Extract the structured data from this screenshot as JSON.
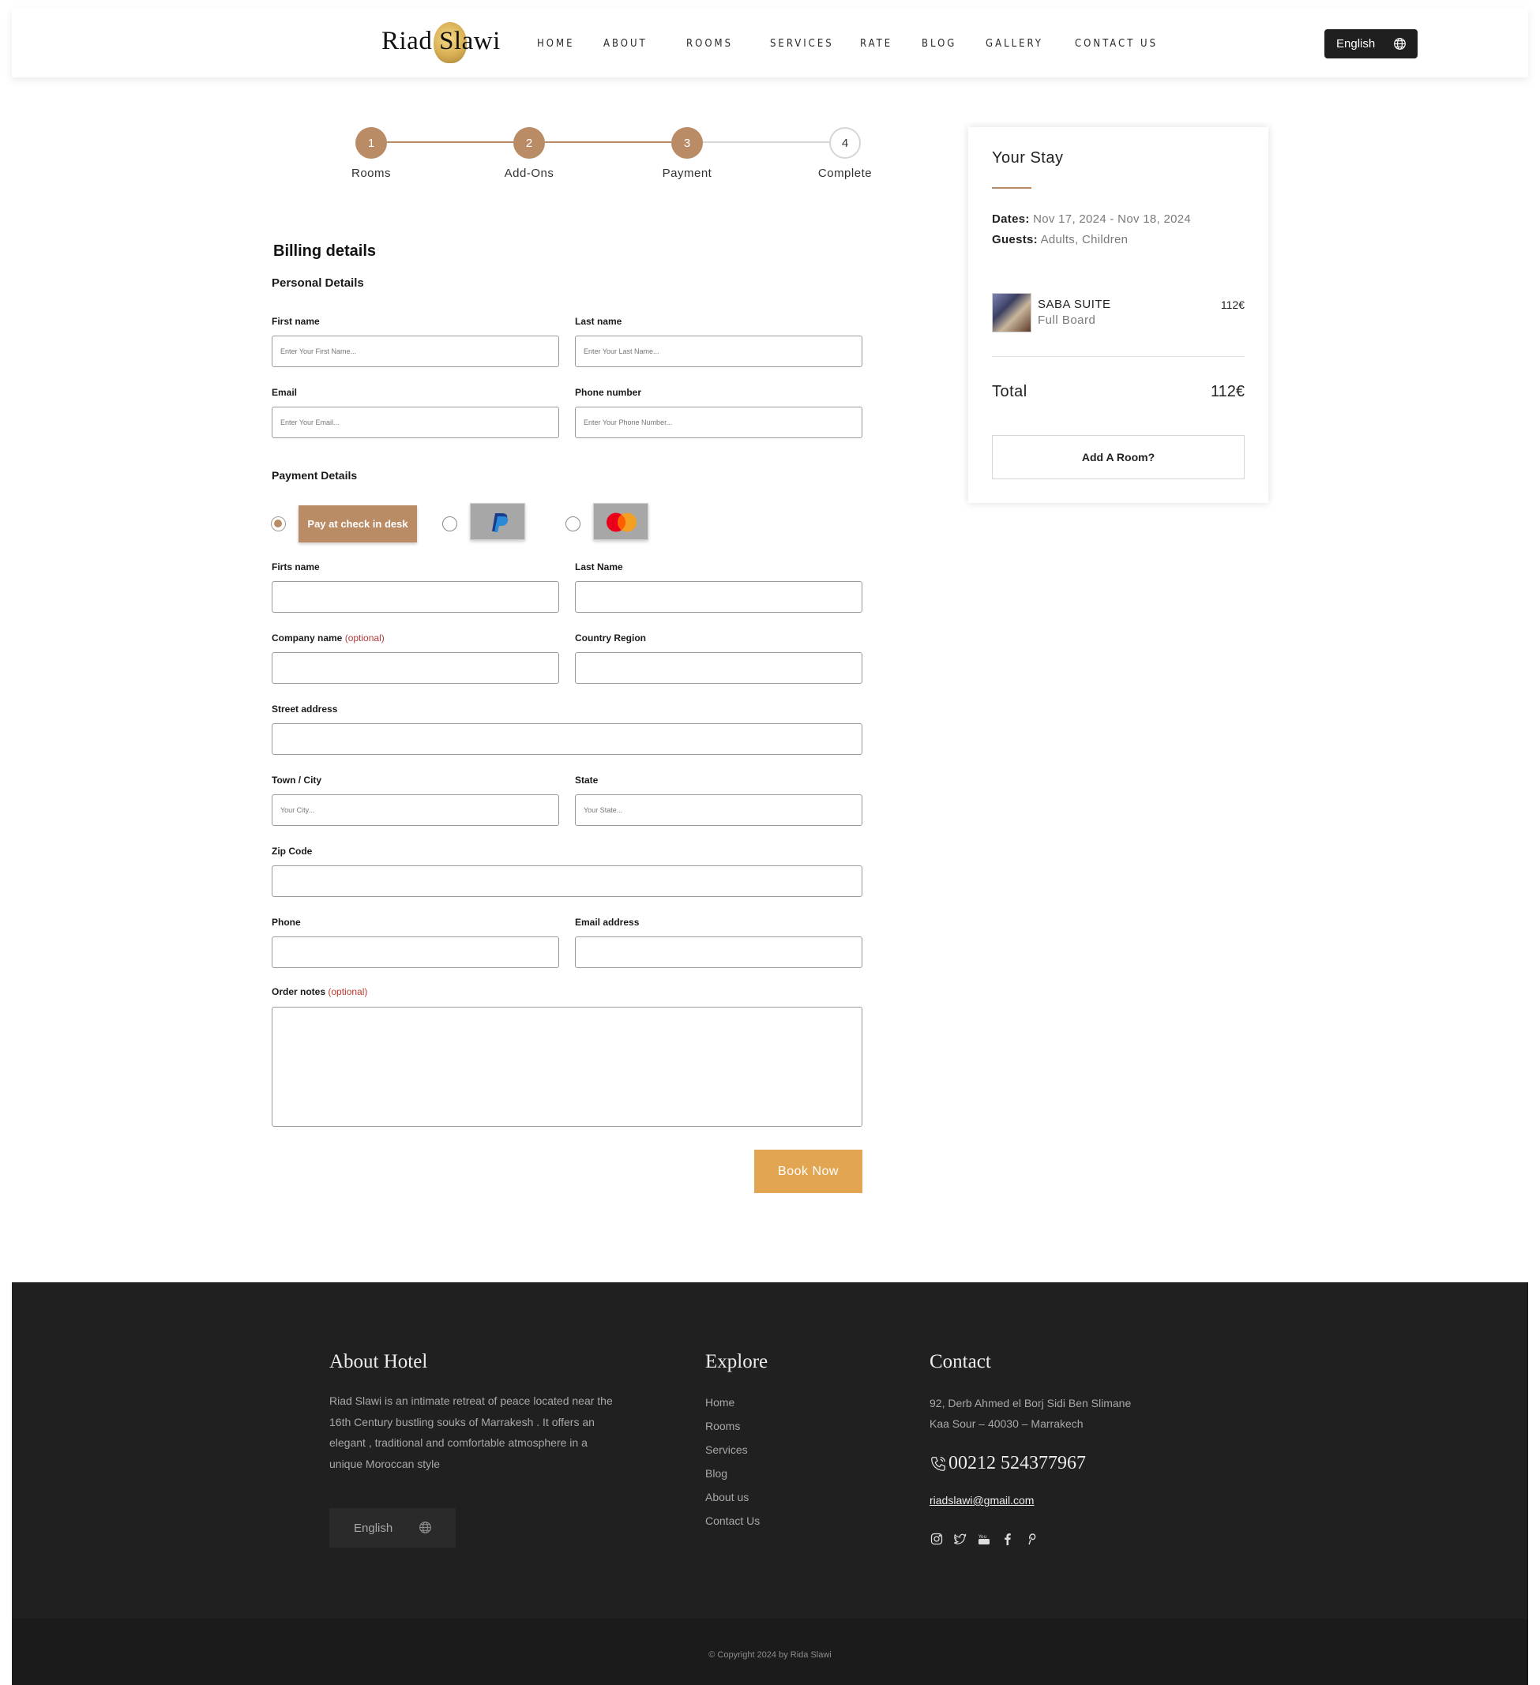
{
  "header": {
    "logo_text": "Riad Slawi",
    "nav": [
      "HOME",
      "ABOUT",
      "ROOMS",
      "SERVICES",
      "RATE",
      "BLOG",
      "GALLERY",
      "CONTACT US"
    ],
    "language": "English"
  },
  "stepper": {
    "steps": [
      {
        "number": "1",
        "label": "Rooms",
        "state": "done"
      },
      {
        "number": "2",
        "label": "Add-Ons",
        "state": "done"
      },
      {
        "number": "3",
        "label": "Payment",
        "state": "active"
      },
      {
        "number": "4",
        "label": "Complete",
        "state": "todo"
      }
    ],
    "accent_color": "#b98c66"
  },
  "billing": {
    "title": "Billing details",
    "personal_title": "Personal Details",
    "first_name_label": "First name",
    "first_name_placeholder": "Enter Your First Name...",
    "last_name_label": "Last name",
    "last_name_placeholder": "Enter Your Last Name...",
    "email_label": "Email",
    "email_placeholder": "Enter Your Email...",
    "phone_label": "Phone number",
    "phone_placeholder": "Enter Your Phone Number...",
    "payment_title": "Payment Details",
    "payment_options": {
      "desk_label": "Pay at check in desk",
      "selected": "desk"
    },
    "firts_name_label": "Firts name",
    "last_name2_label": "Last Name",
    "company_label": "Company name",
    "optional": "(optional)",
    "country_label": "Country Region",
    "street_label": "Street address",
    "town_label": "Town / City",
    "town_placeholder": "Your City...",
    "state_label": "State",
    "state_placeholder": "Your State...",
    "zip_label": "Zip Code",
    "phone2_label": "Phone",
    "email2_label": "Email address",
    "notes_label": "Order notes",
    "book_label": "Book Now",
    "book_color": "#e2a653"
  },
  "stay": {
    "title": "Your Stay",
    "dates_label": "Dates:",
    "dates_value": "Nov 17, 2024 - Nov 18, 2024",
    "guests_label": "Guests:",
    "guests_value": "Adults, Children",
    "room_name": "SABA SUITE",
    "room_board": "Full Board",
    "room_price": "112€",
    "total_label": "Total",
    "total_value": "112€",
    "add_room_label": "Add A Room?"
  },
  "footer": {
    "about_title": "About Hotel",
    "about_text": "Riad Slawi is an intimate retreat of peace located near the 16th Century bustling souks of Marrakesh . It offers an elegant , traditional and comfortable atmosphere in a unique Moroccan style",
    "language": "English",
    "explore_title": "Explore",
    "explore_links": [
      "Home",
      "Rooms",
      "Services",
      "Blog",
      "About us",
      "Contact Us"
    ],
    "contact_title": "Contact",
    "address_line1": "92, Derb Ahmed el Borj Sidi Ben Slimane",
    "address_line2": "Kaa Sour – 40030 – Marrakech",
    "phone": "00212 524377967",
    "email": "riadslawi@gmail.com",
    "social_icons": [
      "instagram-icon",
      "twitter-icon",
      "youtube-icon",
      "facebook-icon",
      "pinterest-icon"
    ],
    "copyright": "© Copyright 2024 by Rida Slawi"
  }
}
